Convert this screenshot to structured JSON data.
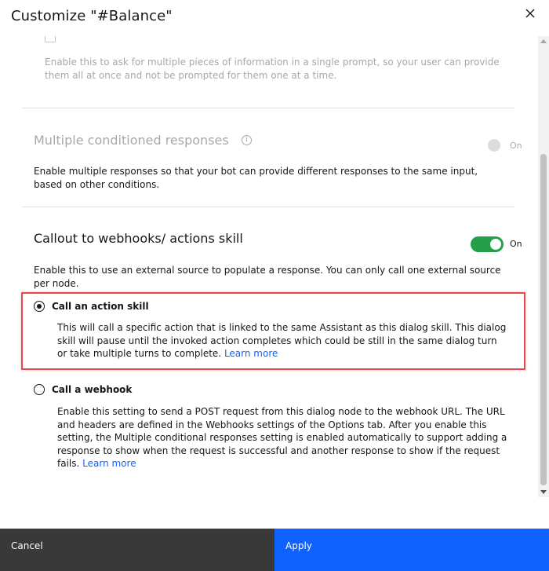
{
  "modal": {
    "title": "Customize \"#Balance\""
  },
  "sections": {
    "multi_prompt": {
      "description": "Enable this to ask for multiple pieces of information in a single prompt, so your user can provide them all at once and not be prompted for them one at a time."
    },
    "multiple_responses": {
      "title": "Multiple conditioned responses",
      "toggle_label": "On",
      "description": "Enable multiple responses so that your bot can provide different responses to the same input, based on other conditions."
    },
    "callout": {
      "title": "Callout to webhooks/ actions skill",
      "toggle_label": "On",
      "description": "Enable this to use an external source to populate a response. You can only call one external source per node.",
      "options": [
        {
          "label": "Call an action skill",
          "selected": true,
          "description": "This will call a specific action that is linked to the same Assistant as this dialog skill. This dialog skill will pause until the invoked action completes which could be still in the same dialog turn or take multiple turns to complete.",
          "link": "Learn more"
        },
        {
          "label": "Call a webhook",
          "selected": false,
          "description": "Enable this setting to send a POST request from this dialog node to the webhook URL. The URL and headers are defined in the Webhooks settings of the Options tab. After you enable this setting, the Multiple conditional responses setting is enabled automatically to support adding a response to show when the request is successful and another response to show if the request fails.",
          "link": "Learn more"
        }
      ]
    }
  },
  "footer": {
    "cancel_label": "Cancel",
    "apply_label": "Apply"
  },
  "colors": {
    "toggle_on": "#24a148",
    "highlight": "#e5484d",
    "link": "#0f62fe",
    "apply_bg": "#0f62fe",
    "cancel_bg": "#393939"
  },
  "icons": {
    "close": "close-icon",
    "info": "info-icon"
  }
}
